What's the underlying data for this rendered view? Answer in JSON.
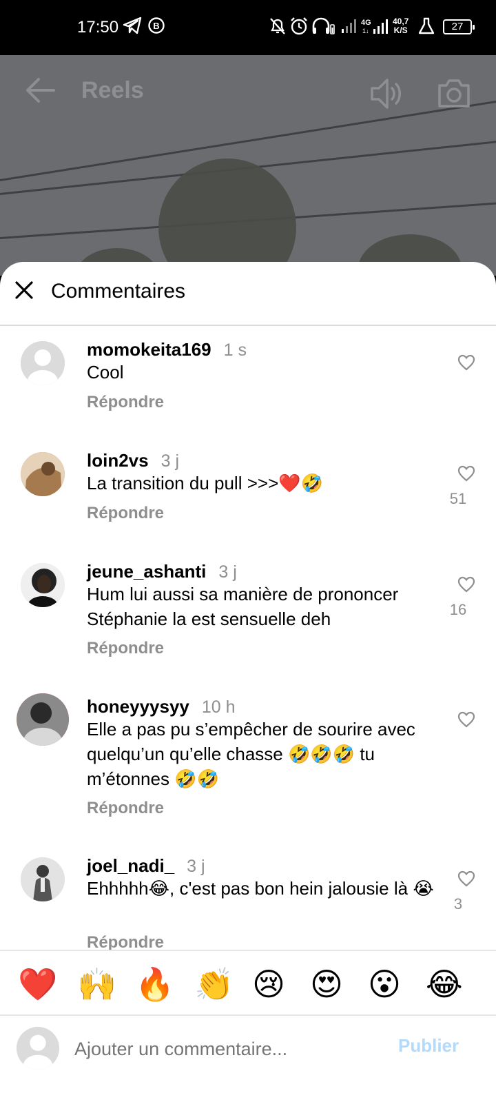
{
  "status_bar": {
    "time": "17:50",
    "icons": [
      "telegram-icon",
      "b-circle-icon",
      "bell-off-icon",
      "alarm-icon",
      "headphones-icon",
      "signal-icon",
      "4g-signal-icon"
    ],
    "network_speed_value": "40,7",
    "network_speed_unit": "K/S",
    "battery": "27"
  },
  "video": {
    "title": "Reels"
  },
  "comments_sheet": {
    "title": "Commentaires",
    "reply_label": "Répondre",
    "comments": [
      {
        "username": "momokeita169",
        "time": "1 s",
        "text": "Cool",
        "likes": ""
      },
      {
        "username": "loin2vs",
        "time": "3 j",
        "text": "La transition du pull >>>❤️🤣",
        "likes": "51"
      },
      {
        "username": "jeune_ashanti",
        "time": "3 j",
        "text": "Hum lui aussi sa manière de prononcer Stéphanie la est sensuelle deh",
        "likes": "16"
      },
      {
        "username": "honeyyysyy",
        "time": "10 h",
        "text": "Elle a pas pu s’empêcher de sourire avec quelqu’un qu’elle chasse 🤣🤣🤣 tu m’étonnes 🤣🤣",
        "likes": ""
      },
      {
        "username": "joel_nadi_",
        "time": "3 j",
        "text": "Ehhhhh😂, c'est pas bon hein jalousie là 😭",
        "likes": "3"
      }
    ]
  },
  "emoji_bar": [
    "❤️",
    "🙌",
    "🔥",
    "👏",
    "😢",
    "😍",
    "😮",
    "😂"
  ],
  "input": {
    "placeholder": "Ajouter un commentaire...",
    "publish_label": "Publier"
  }
}
